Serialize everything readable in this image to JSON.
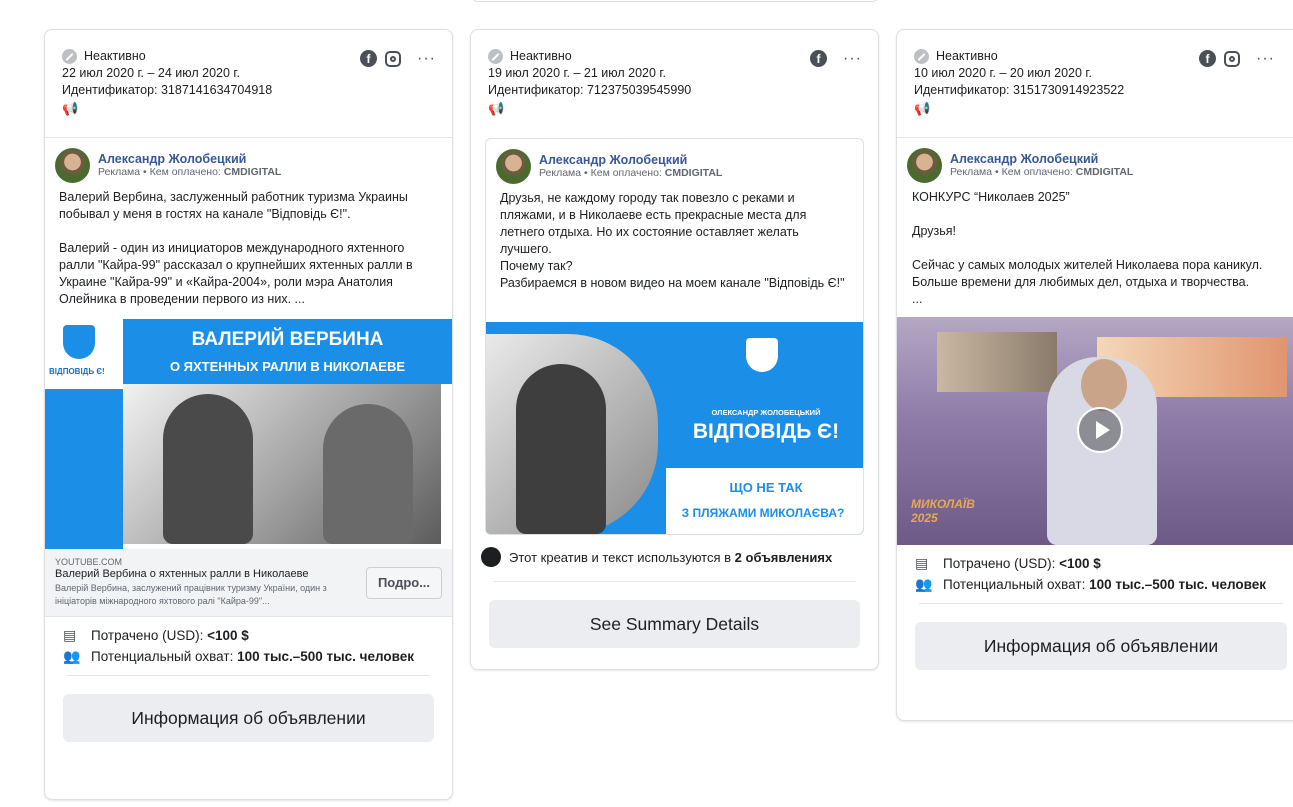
{
  "cards": [
    {
      "status": "Неактивно",
      "dates": "22 июл 2020 г. – 24 июл 2020 г.",
      "id_label": "Идентификатор: 3187141634704918",
      "author": "Александр Жолобецкий",
      "sponsor_prefix": "Реклама • Кем оплачено: ",
      "sponsor_name": "CMDIGITAL",
      "text": "Валерий Вербина, заслуженный работник туризма Украины побывал у меня в гостях на канале \"Відповідь Є!\".\n\nВалерий - один из инициаторов международного яхтенного ралли \"Кайра-99\" рассказал о крупнейших яхтенных ралли в Украине \"Кайра-99\" и «Кайра-2004», роли мэра Анатолия Олейника в проведении первого из них. ...",
      "banner_title": "ВАЛЕРИЙ ВЕРБИНА",
      "banner_subtitle": "О ЯХТЕННЫХ РАЛЛИ В НИКОЛАЕВЕ",
      "banner_logo": "ВІДПОВІДЬ Є!",
      "link_domain": "YOUTUBE.COM",
      "link_title": "Валерий Вербина о яхтенных ралли в Николаеве",
      "link_desc": "Валерій Вербина, заслужений працівник туризму України, один з ініціаторів міжнародного яхтового ралі \"Кайра-99\"...",
      "more_label": "Подро...",
      "spent_label": "Потрачено (USD): ",
      "spent_value": "<100 $",
      "reach_label": "Потенциальный охват: ",
      "reach_value": "100 тыс.–500 тыс. человек",
      "button": "Информация об объявлении"
    },
    {
      "status": "Неактивно",
      "dates": "19 июл 2020 г. – 21 июл 2020 г.",
      "id_label": "Идентификатор: 712375039545990",
      "author": "Александр Жолобецкий",
      "sponsor_prefix": "Реклама • Кем оплачено: ",
      "sponsor_name": "CMDIGITAL",
      "text": "Друзья, не каждому городу так повезло с реками и пляжами, и в Николаеве есть прекрасные места для летнего отдыха. Но их состояние оставляет желать лучшего.\nПочему так?\nРазбираемся в новом видео на моем канале \"Відповідь Є!\"",
      "banner_small": "ОЛЕКСАНДР ЖОЛОБЕЦЬКИЙ",
      "banner_logo": "ВІДПОВІДЬ Є!",
      "banner_line1": "ЩО НЕ ТАК",
      "banner_line2": "З ПЛЯЖАМИ МИКОЛАЄВА?",
      "creative_prefix": "Этот креатив и текст используются в ",
      "creative_bold": "2 объявлениях",
      "button": "See Summary Details"
    },
    {
      "status": "Неактивно",
      "dates": "10 июл 2020 г. – 20 июл 2020 г.",
      "id_label": "Идентификатор: 3151730914923522",
      "author": "Александр Жолобецкий",
      "sponsor_prefix": "Реклама • Кем оплачено: ",
      "sponsor_name": "CMDIGITAL",
      "text": "КОНКУРС “Николаев 2025”\n\nДрузья!\n\nСейчас у самых молодых жителей Николаева пора каникул. Больше времени для любимых дел, отдыха и творчества.\n...",
      "video_logo": "МИКОЛАЇВ 2025",
      "spent_label": "Потрачено (USD): ",
      "spent_value": "<100 $",
      "reach_label": "Потенциальный охват: ",
      "reach_value": "100 тыс.–500 тыс. человек",
      "button": "Информация об объявлении"
    }
  ],
  "colors": {
    "accent_blue": "#1b8fe8",
    "author_link": "#385898",
    "button_bg": "#ebedf0"
  },
  "icons": [
    "facebook-icon",
    "instagram-icon",
    "more-icon",
    "inactive-icon",
    "megaphone-icon",
    "wallet-icon",
    "people-icon",
    "play-icon",
    "creative-icon"
  ]
}
